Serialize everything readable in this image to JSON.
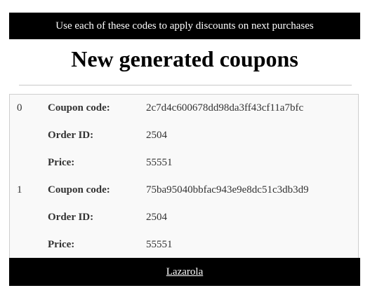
{
  "banner": {
    "text": "Use each of these codes to apply discounts on next purchases"
  },
  "title": "New generated coupons",
  "coupons": [
    {
      "index": "0",
      "code_label": "Coupon code:",
      "code": "2c7d4c600678dd98da3ff43cf11a7bfc",
      "order_label": "Order ID:",
      "order_id": "2504",
      "price_label": "Price:",
      "price": "55551"
    },
    {
      "index": "1",
      "code_label": "Coupon code:",
      "code": "75ba95040bbfac943e9e8dc51c3db3d9",
      "order_label": "Order ID:",
      "order_id": "2504",
      "price_label": "Price:",
      "price": "55551"
    }
  ],
  "footer": {
    "link_text": "Lazarola"
  }
}
